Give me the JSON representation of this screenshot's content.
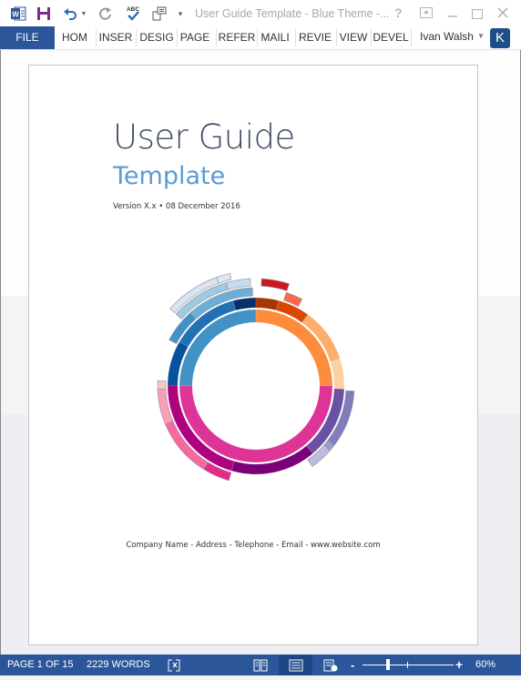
{
  "titlebar": {
    "title": "User Guide Template - Blue Theme -...",
    "help_label": "?",
    "icons": [
      "word-app-icon",
      "save-icon",
      "undo-icon",
      "redo-icon",
      "spelling-icon",
      "touch-mode-icon",
      "customize-qat-icon"
    ]
  },
  "ribbon": {
    "file_label": "FILE",
    "tabs": [
      "HOM",
      "INSER",
      "DESIG",
      "PAGE",
      "REFER",
      "MAILI",
      "REVIE",
      "VIEW",
      "DEVEL"
    ],
    "user_name": "Ivan Walsh",
    "avatar_letter": "K"
  },
  "document": {
    "title": "User Guide",
    "subtitle": "Template",
    "version_line": "Version X.x • 08 December 2016",
    "footer_line": "Company Name - Address - Telephone - Email - www.website.com"
  },
  "statusbar": {
    "page": "PAGE 1 OF 15",
    "words": "2229 WORDS",
    "zoom_minus": "-",
    "zoom_plus": "+",
    "zoom_level": "60%",
    "zoom_percent": 60
  },
  "colors": {
    "accent": "#2b579a",
    "title_color": "#3e4a63",
    "subtitle_color": "#5b9bd5"
  },
  "chart_data": {
    "type": "sunburst-decoration",
    "note": "Decorative multi-ring arc graphic; angles in degrees clockwise from 12 o'clock",
    "rings": [
      {
        "ring": 1,
        "segments": [
          {
            "start": 270,
            "end": 360,
            "color": "#4292c6"
          },
          {
            "start": 0,
            "end": 90,
            "color": "#fd8d3c"
          },
          {
            "start": 90,
            "end": 270,
            "color": "#dd3497"
          }
        ]
      },
      {
        "ring": 2,
        "segments": [
          {
            "start": 270,
            "end": 300,
            "color": "#08519c"
          },
          {
            "start": 300,
            "end": 345,
            "color": "#2171b5"
          },
          {
            "start": 345,
            "end": 360,
            "color": "#08306b"
          },
          {
            "start": 0,
            "end": 15,
            "color": "#a63603"
          },
          {
            "start": 15,
            "end": 36,
            "color": "#d94801"
          },
          {
            "start": 36,
            "end": 72,
            "color": "#fdae6b"
          },
          {
            "start": 72,
            "end": 92,
            "color": "#fdd0a2"
          },
          {
            "start": 92,
            "end": 140,
            "color": "#6a51a3"
          },
          {
            "start": 140,
            "end": 196,
            "color": "#7a0177"
          },
          {
            "start": 196,
            "end": 270,
            "color": "#ae017e"
          }
        ]
      },
      {
        "ring": 3,
        "segments": [
          {
            "start": 298,
            "end": 318,
            "color": "#4292c6"
          },
          {
            "start": 318,
            "end": 358,
            "color": "#6baed6"
          },
          {
            "start": 18,
            "end": 28,
            "color": "#fc6a4a"
          },
          {
            "start": 93,
            "end": 127,
            "color": "#807dba"
          },
          {
            "start": 127,
            "end": 131,
            "color": "#9e9ac8"
          },
          {
            "start": 131,
            "end": 145,
            "color": "#bcbddc"
          },
          {
            "start": 196,
            "end": 212,
            "color": "#e7298a"
          },
          {
            "start": 212,
            "end": 247,
            "color": "#f768a1"
          },
          {
            "start": 247,
            "end": 268,
            "color": "#fa9fb5"
          },
          {
            "start": 268,
            "end": 273,
            "color": "#fcc5c0"
          }
        ]
      },
      {
        "ring": 4,
        "segments": [
          {
            "start": 312,
            "end": 344,
            "color": "#9ecae1"
          },
          {
            "start": 344,
            "end": 357,
            "color": "#c6dbef"
          },
          {
            "start": 3,
            "end": 18,
            "color": "#cb181d"
          }
        ]
      },
      {
        "ring": 5,
        "segments": [
          {
            "start": 312,
            "end": 340,
            "color": "#dbe4f0"
          },
          {
            "start": 340,
            "end": 347,
            "color": "#dee6f2"
          }
        ]
      }
    ]
  }
}
